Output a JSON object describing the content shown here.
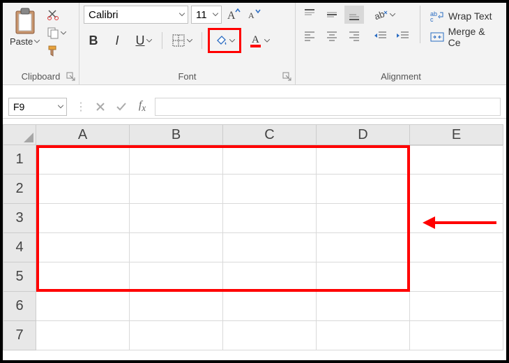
{
  "ribbon": {
    "clipboard": {
      "label": "Clipboard",
      "paste_label": "Paste"
    },
    "font": {
      "label": "Font",
      "name": "Calibri",
      "size": "11",
      "bold": "B",
      "italic": "I",
      "underline": "U"
    },
    "alignment": {
      "label": "Alignment",
      "wrap": "Wrap Text",
      "merge": "Merge & Ce"
    }
  },
  "namebox": "F9",
  "columns": [
    "A",
    "B",
    "C",
    "D",
    "E"
  ],
  "rows": [
    "1",
    "2",
    "3",
    "4",
    "5",
    "6",
    "7"
  ],
  "chart_data": {
    "type": "table",
    "title": "",
    "columns": [
      "A",
      "B",
      "C",
      "D",
      "E"
    ],
    "rows": [
      [
        "",
        "",
        "",
        "",
        ""
      ],
      [
        "",
        "",
        "",
        "",
        ""
      ],
      [
        "",
        "",
        "",
        "",
        ""
      ],
      [
        "",
        "",
        "",
        "",
        ""
      ],
      [
        "",
        "",
        "",
        "",
        ""
      ],
      [
        "",
        "",
        "",
        "",
        ""
      ],
      [
        "",
        "",
        "",
        "",
        ""
      ]
    ],
    "selection": "A1:D5"
  }
}
